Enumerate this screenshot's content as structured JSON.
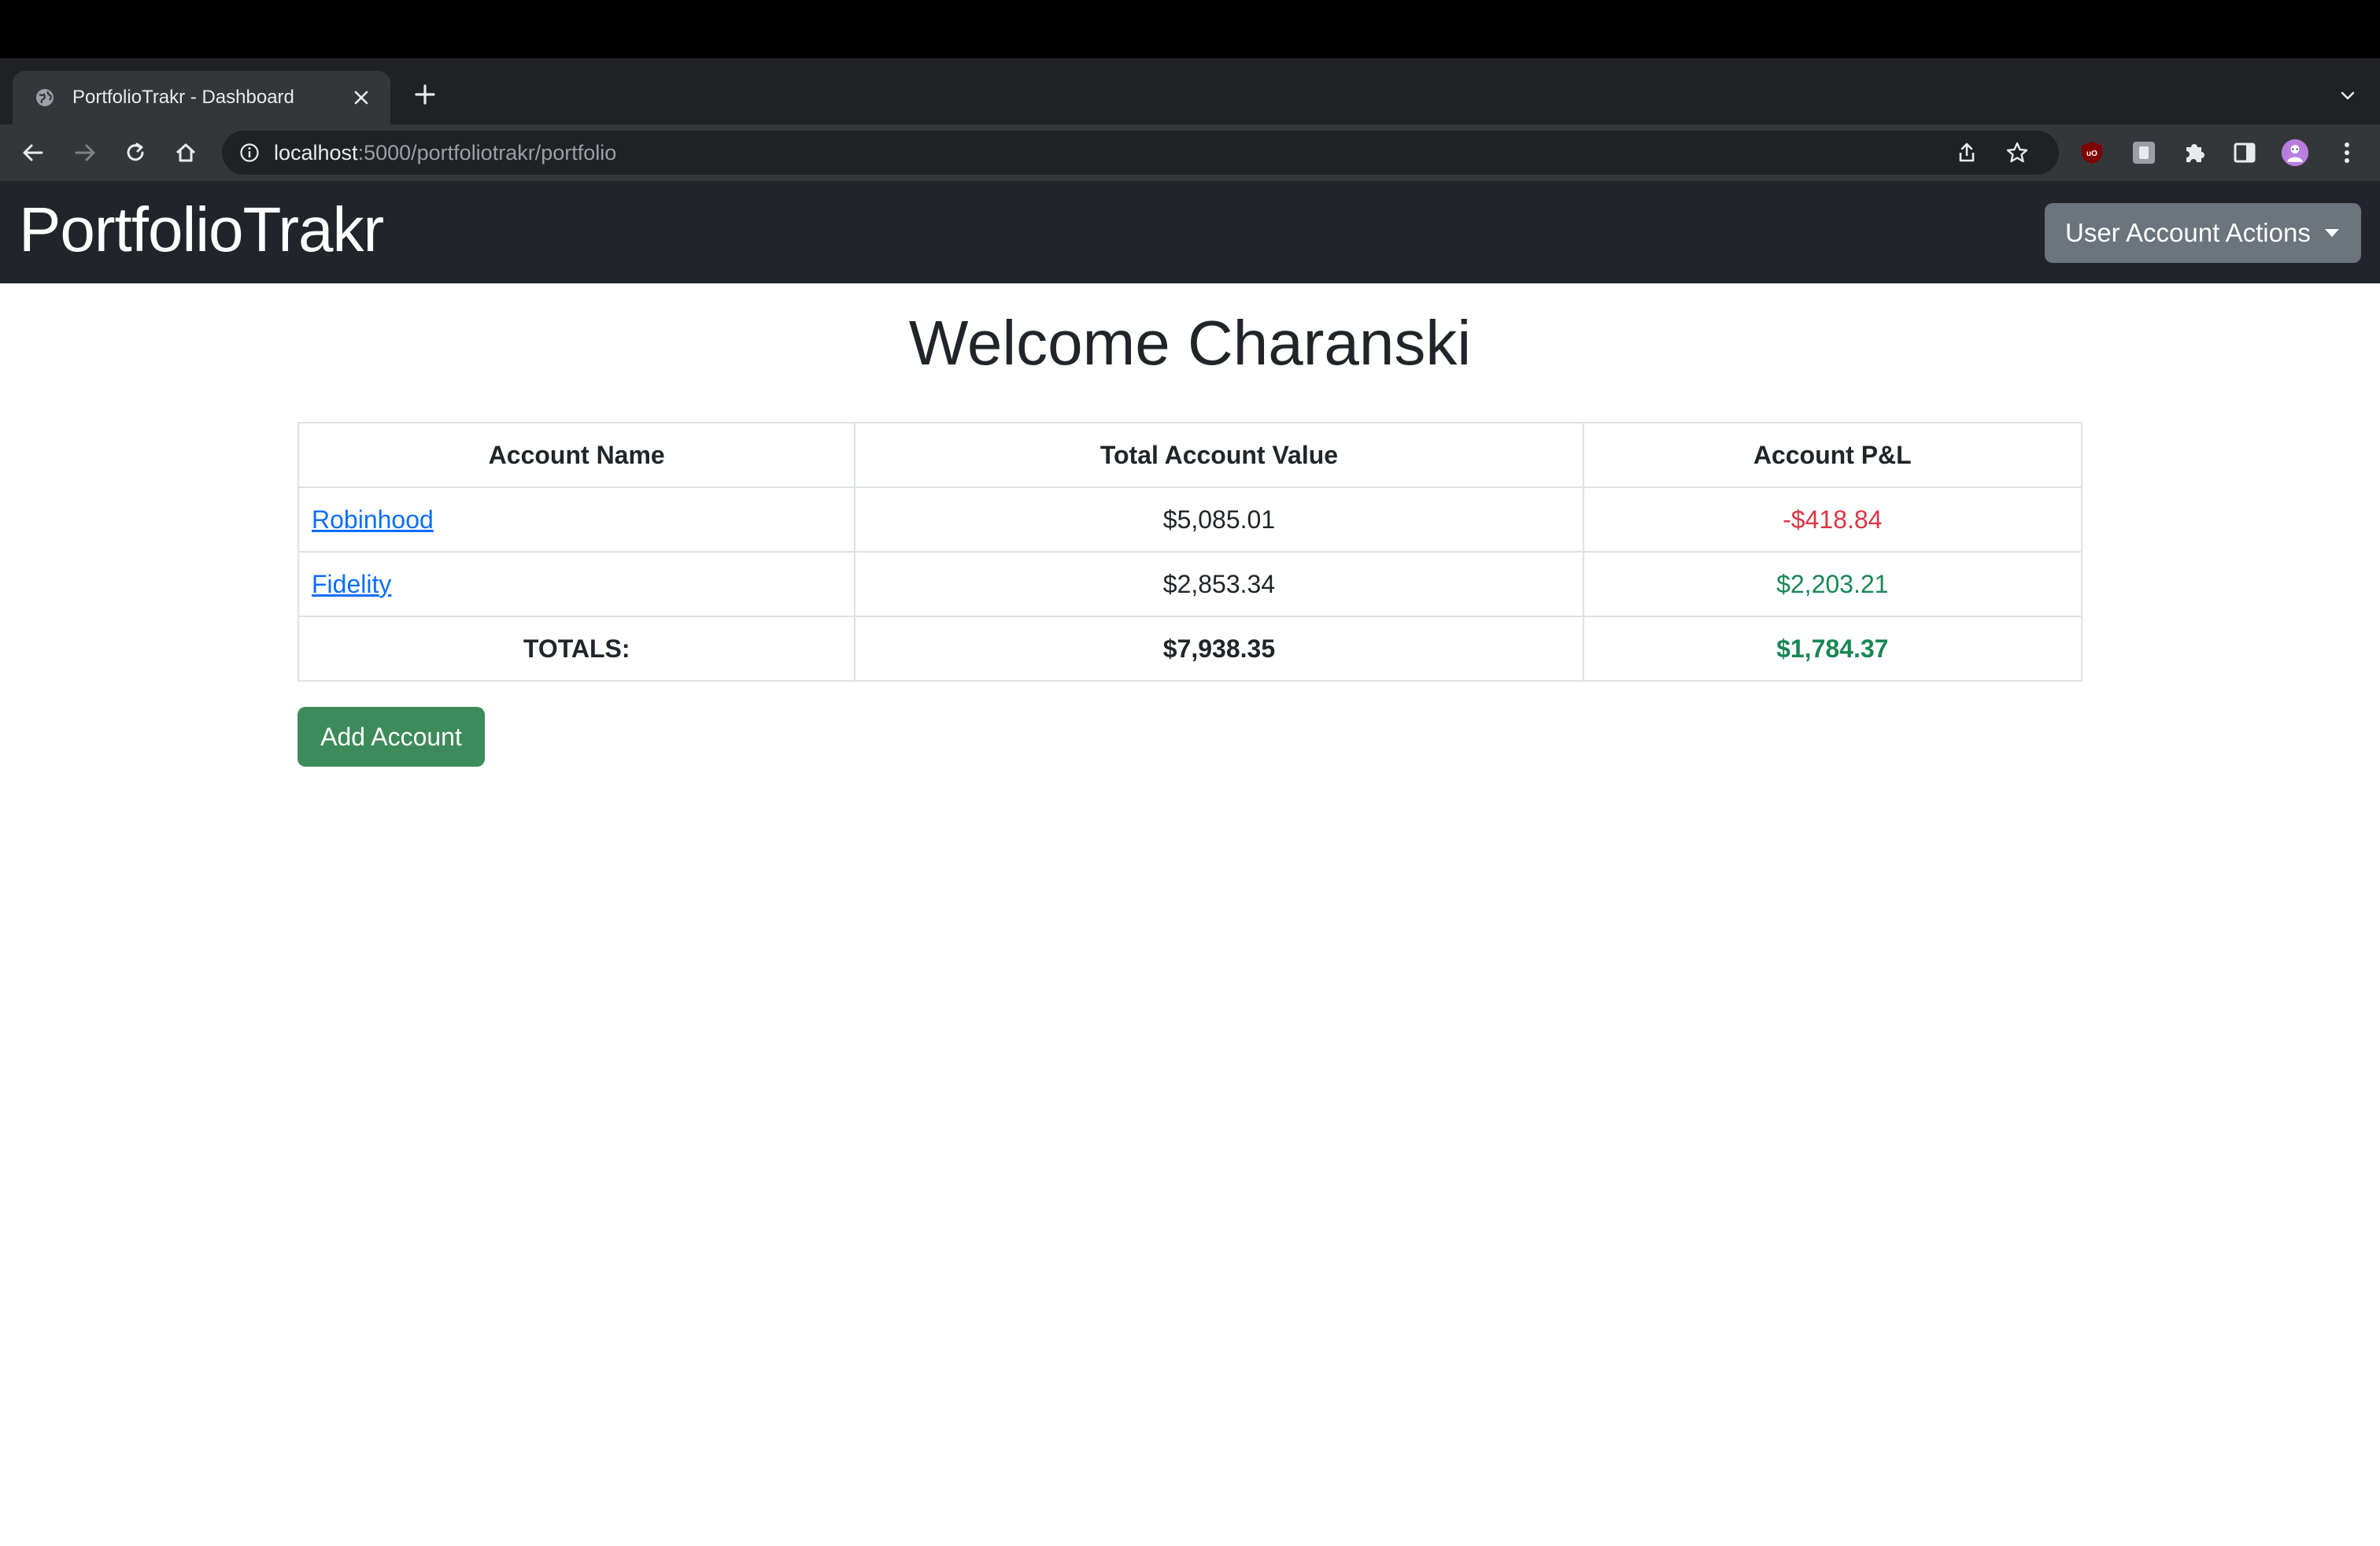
{
  "browser": {
    "tab_title": "PortfolioTrakr - Dashboard",
    "url_host": "localhost",
    "url_rest": ":5000/portfoliotrakr/portfolio"
  },
  "icons": {
    "favicon": "globe-icon",
    "close": "close-icon",
    "new_tab": "plus-icon",
    "tab_search": "chevron-down-icon",
    "back": "back-arrow-icon",
    "forward": "forward-arrow-icon",
    "reload": "reload-icon",
    "home": "home-icon",
    "info": "info-icon",
    "share": "share-icon",
    "bookmark": "star-icon",
    "ublock": "ublock-extension-icon",
    "ext2": "extension-icon",
    "extensions": "puzzle-icon",
    "sidepanel": "side-panel-icon",
    "profile": "profile-avatar",
    "menu": "kebab-menu-icon"
  },
  "navbar": {
    "brand": "PortfolioTrakr",
    "user_actions": "User Account Actions"
  },
  "page": {
    "welcome": "Welcome Charanski"
  },
  "table": {
    "headers": [
      "Account Name",
      "Total Account Value",
      "Account P&L"
    ],
    "rows": [
      {
        "name": "Robinhood",
        "value": "$5,085.01",
        "pnl": "-$418.84"
      },
      {
        "name": "Fidelity",
        "value": "$2,853.34",
        "pnl": "$2,203.21"
      }
    ],
    "totals": {
      "label": "TOTALS:",
      "value": "$7,938.35",
      "pnl": "$1,784.37"
    }
  },
  "actions": {
    "add_account": "Add Account"
  },
  "colors": {
    "negative": "#dc3545",
    "positive": "#198754",
    "link": "#0d6efd",
    "navbar_bg": "#212529",
    "add_button": "#3d8b5a",
    "dropdown_button": "#6c757d"
  }
}
